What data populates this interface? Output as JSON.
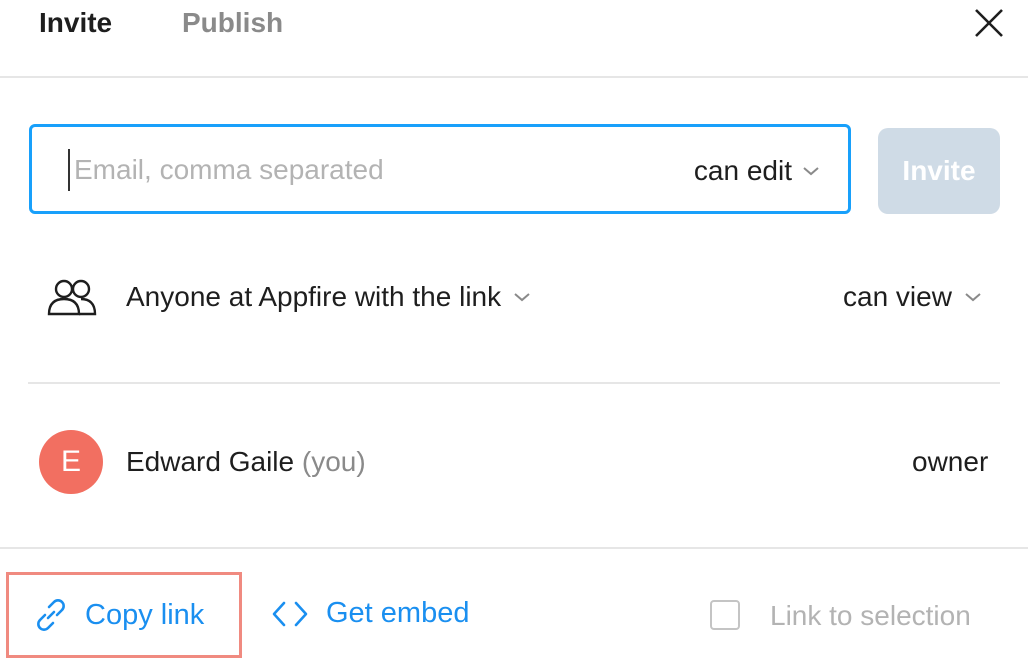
{
  "tabs": [
    {
      "label": "Invite",
      "active": true
    },
    {
      "label": "Publish",
      "active": false
    }
  ],
  "close_icon": "close-icon",
  "invite_form": {
    "email_placeholder": "Email, comma separated",
    "email_value": "",
    "permission": "can edit",
    "invite_label": "Invite"
  },
  "link_access": {
    "scope": "Anyone at Appfire with the link",
    "permission": "can view"
  },
  "members": [
    {
      "initial": "E",
      "name": "Edward Gaile",
      "suffix": "(you)",
      "role": "owner",
      "avatar_color": "#f26f61"
    }
  ],
  "footer": {
    "copy_link": "Copy link",
    "get_embed": "Get embed",
    "link_to_selection": "Link to selection",
    "link_to_selection_checked": false
  },
  "colors": {
    "accent": "#18a0fb",
    "link_blue": "#1a8ff0",
    "invite_disabled": "#cfdbe6",
    "highlight_border": "#f08a80"
  }
}
